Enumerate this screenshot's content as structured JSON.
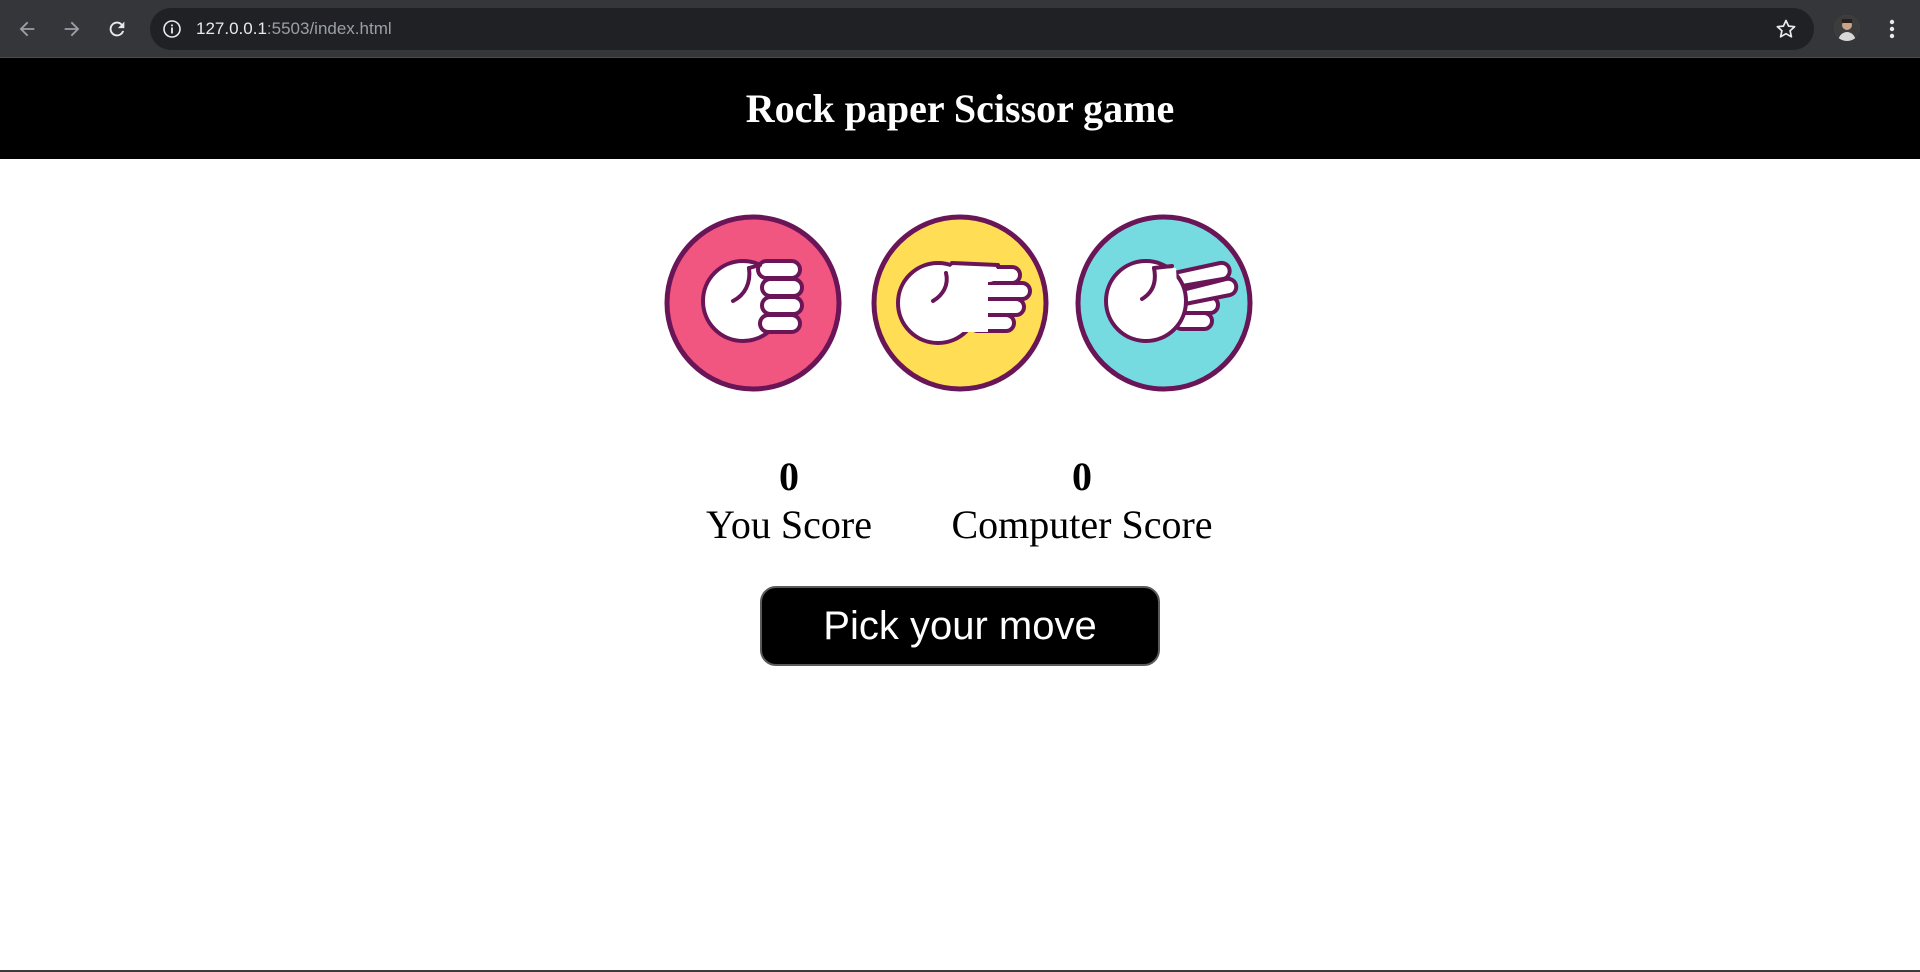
{
  "browser": {
    "url_host": "127.0.0.1",
    "url_rest": ":5503/index.html",
    "icons": [
      "back-arrow-icon",
      "forward-arrow-icon",
      "reload-icon",
      "info-icon",
      "star-icon",
      "kebab-menu-icon"
    ]
  },
  "page": {
    "title": "Rock paper Scissor game"
  },
  "choices": [
    {
      "name": "rock",
      "color": "#f0567f"
    },
    {
      "name": "paper",
      "color": "#ffde55"
    },
    {
      "name": "scissors",
      "color": "#76dbe1"
    }
  ],
  "scores": {
    "user_value": "0",
    "user_label": "You Score",
    "computer_value": "0",
    "computer_label": "Computer Score"
  },
  "message": "Pick your move",
  "colors": {
    "header_bg": "#000000",
    "outline": "#6a1557"
  }
}
